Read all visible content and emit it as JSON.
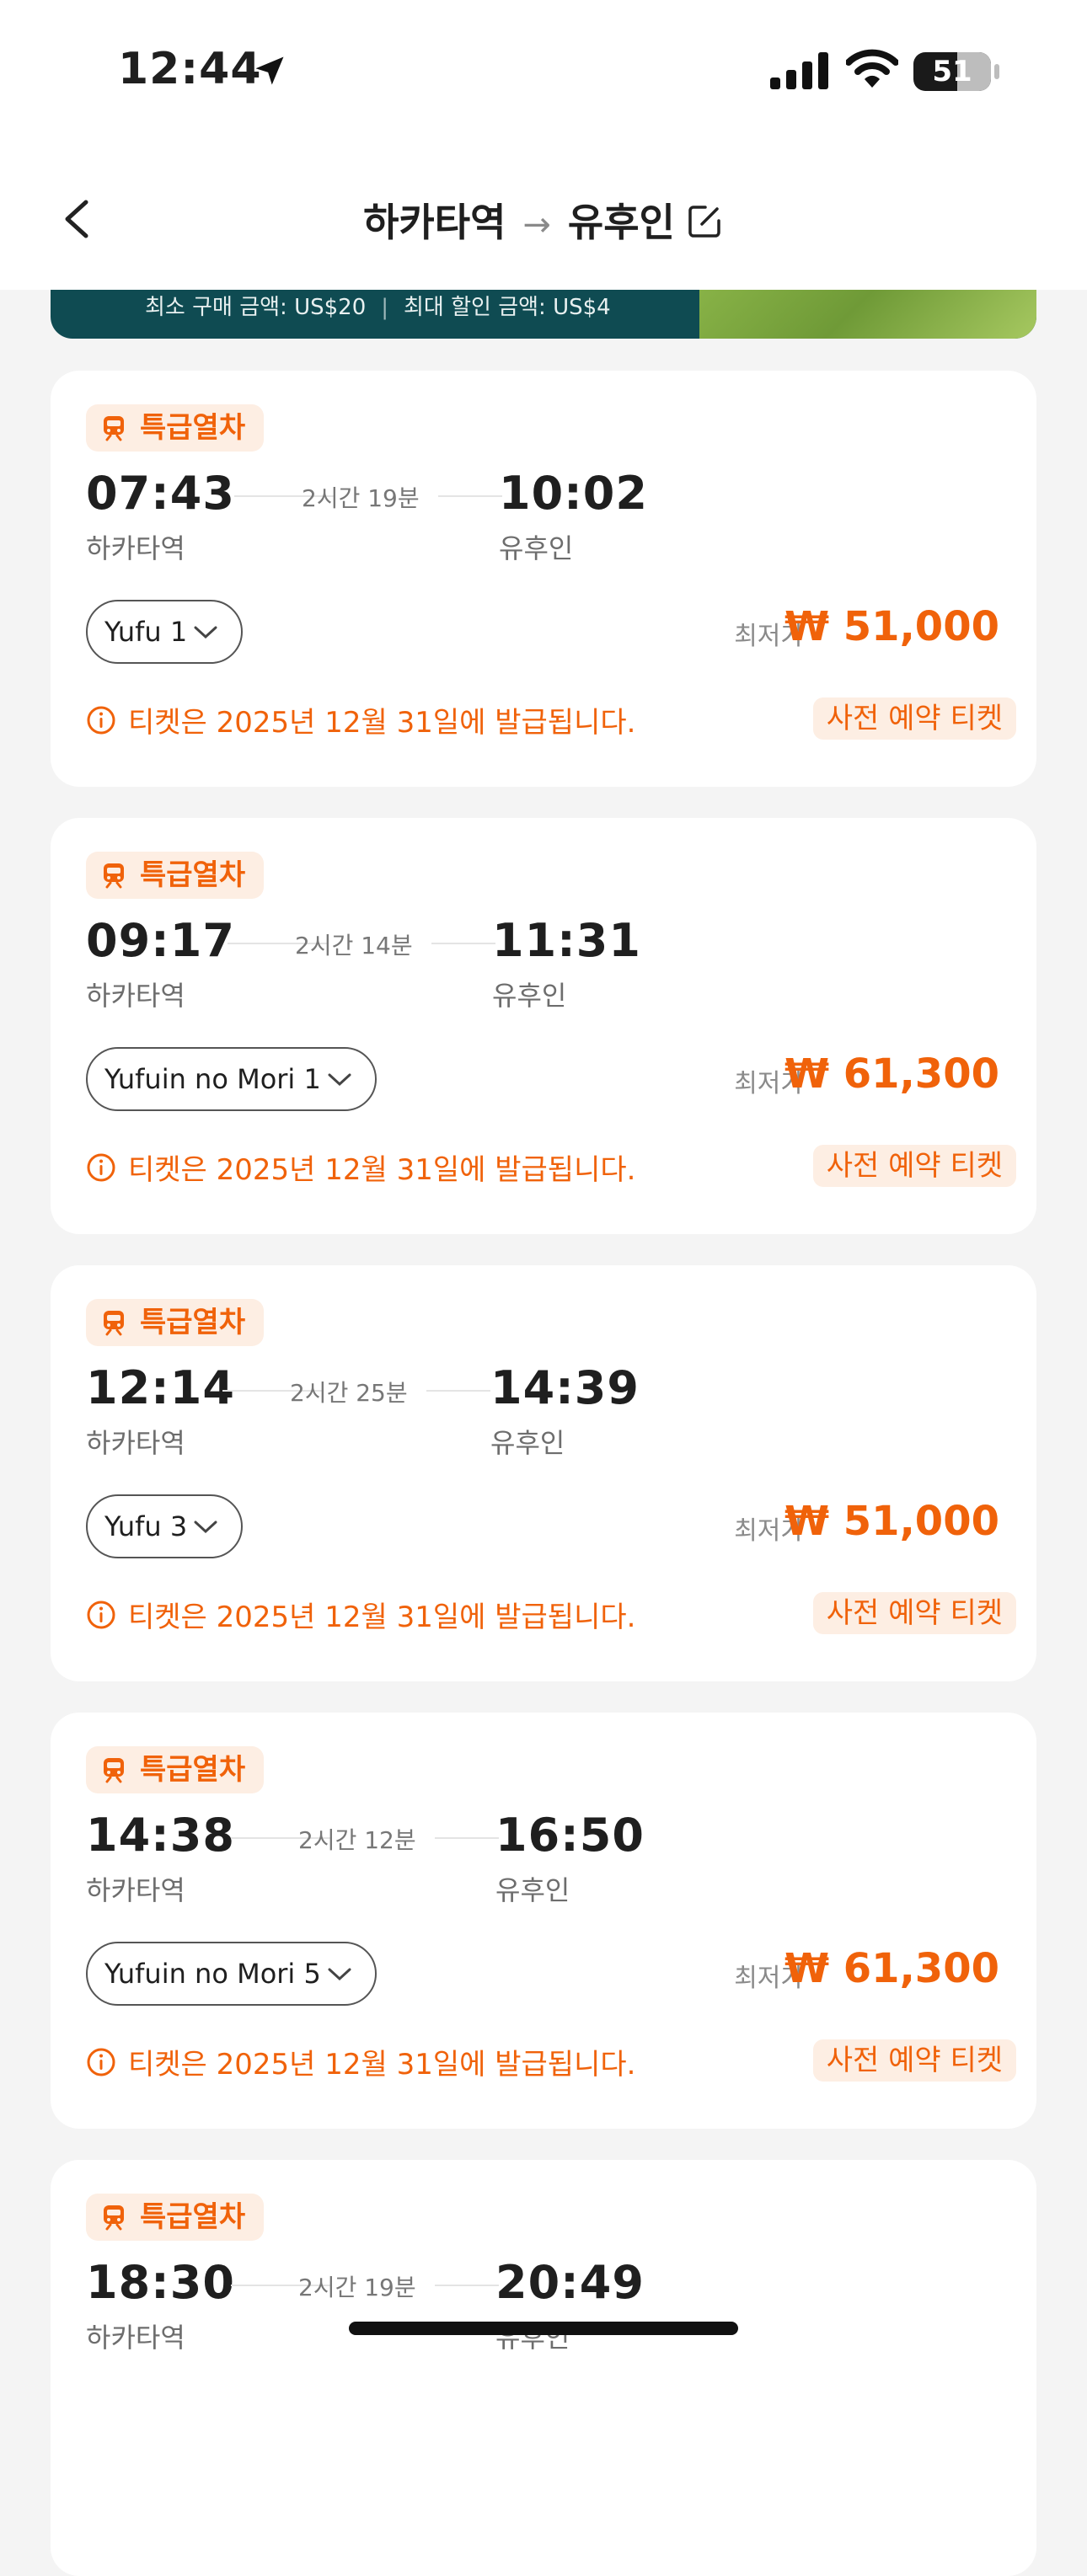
{
  "status_bar": {
    "time": "12:44",
    "battery": "51"
  },
  "header": {
    "origin": "하카타역",
    "arrow": "→",
    "destination": "유후인"
  },
  "banner": {
    "min_purchase": "최소 구매 금액: US$20",
    "separator": "|",
    "max_discount": "최대 할인 금액: US$4"
  },
  "common": {
    "badge": "특급열차",
    "price_label": "최저가",
    "notice": "티켓은 2025년 12월 31일에 발급됩니다.",
    "tag": "사전 예약 티켓"
  },
  "colors": {
    "accent": "#f0620a",
    "accent_bg": "#fdeee3"
  },
  "trains": [
    {
      "dep_time": "07:43",
      "duration": "2시간 19분",
      "arr_time": "10:02",
      "dep_station": "하카타역",
      "arr_station": "유후인",
      "train_name": "Yufu 1",
      "price": "₩ 51,000"
    },
    {
      "dep_time": "09:17",
      "duration": "2시간 14분",
      "arr_time": "11:31",
      "dep_station": "하카타역",
      "arr_station": "유후인",
      "train_name": "Yufuin no Mori 1",
      "price": "₩ 61,300"
    },
    {
      "dep_time": "12:14",
      "duration": "2시간 25분",
      "arr_time": "14:39",
      "dep_station": "하카타역",
      "arr_station": "유후인",
      "train_name": "Yufu 3",
      "price": "₩ 51,000"
    },
    {
      "dep_time": "14:38",
      "duration": "2시간 12분",
      "arr_time": "16:50",
      "dep_station": "하카타역",
      "arr_station": "유후인",
      "train_name": "Yufuin no Mori 5",
      "price": "₩ 61,300"
    },
    {
      "dep_time": "18:30",
      "duration": "2시간 19분",
      "arr_time": "20:49",
      "dep_station": "하카타역",
      "arr_station": "유후인"
    }
  ]
}
